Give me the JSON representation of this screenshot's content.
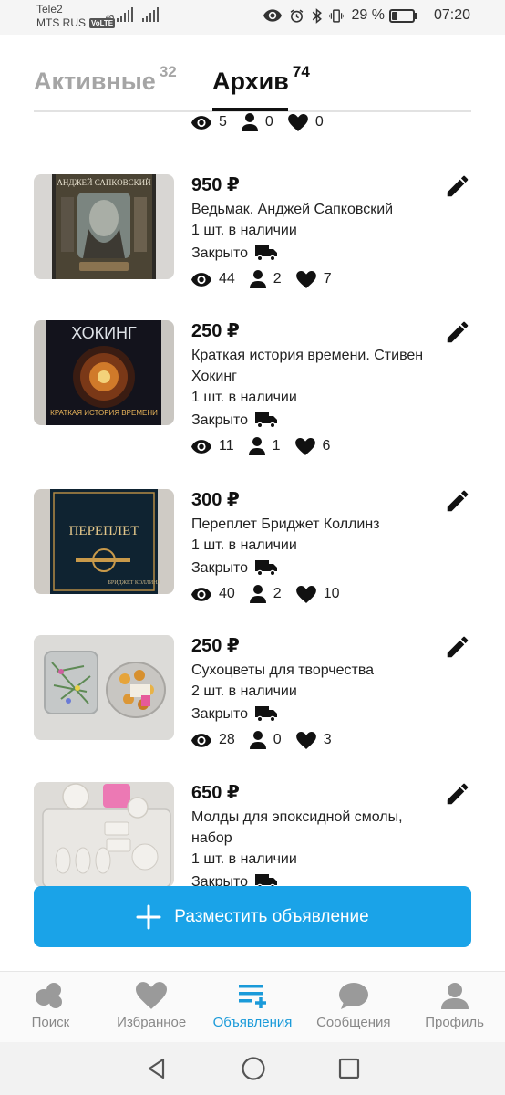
{
  "status_bar": {
    "carrier1": "Tele2",
    "carrier2": "MTS RUS",
    "volte": "VoLTE",
    "net1": "4G",
    "battery_text": "29 %",
    "battery_level": 0.29,
    "time": "07:20"
  },
  "tabs": [
    {
      "label": "Активные",
      "count": "32"
    },
    {
      "label": "Архив",
      "count": "74"
    }
  ],
  "partial_listing": {
    "views": "5",
    "contacts": "0",
    "likes": "0"
  },
  "listings": [
    {
      "price": "950 ₽",
      "title": "Ведьмак. Анджей Сапковский",
      "stock": "1 шт. в наличии",
      "status": "Закрыто",
      "views": "44",
      "contacts": "2",
      "likes": "7",
      "cover_text": "АНДЖЕЙ САПКОВСКИЙ"
    },
    {
      "price": "250 ₽",
      "title": "Краткая история времени. Стивен Хокинг",
      "stock": "1 шт. в наличии",
      "status": "Закрыто",
      "views": "11",
      "contacts": "1",
      "likes": "6",
      "cover_text": "ХОКИНГ",
      "cover_text2": "КРАТКАЯ ИСТОРИЯ ВРЕМЕНИ"
    },
    {
      "price": "300 ₽",
      "title": "Переплет Бриджет Коллинз",
      "stock": "1 шт. в наличии",
      "status": "Закрыто",
      "views": "40",
      "contacts": "2",
      "likes": "10",
      "cover_text": "ПЕРЕПЛЕТ",
      "cover_text2": "БРИДЖЕТ КОЛЛИНЗ"
    },
    {
      "price": "250 ₽",
      "title": "Сухоцветы для творчества",
      "stock": "2 шт. в наличии",
      "status": "Закрыто",
      "views": "28",
      "contacts": "0",
      "likes": "3"
    },
    {
      "price": "650 ₽",
      "title": "Молды для эпоксидной смолы, набор",
      "stock": "1 шт. в наличии",
      "status": "Закрыто"
    }
  ],
  "cta_label": "Разместить объявление",
  "bottom_nav": [
    {
      "label": "Поиск",
      "icon": "search-dots-icon"
    },
    {
      "label": "Избранное",
      "icon": "heart-icon"
    },
    {
      "label": "Объявления",
      "icon": "listings-add-icon",
      "active": true
    },
    {
      "label": "Сообщения",
      "icon": "chat-icon"
    },
    {
      "label": "Профиль",
      "icon": "profile-icon"
    }
  ],
  "colors": {
    "accent": "#1aa3e8",
    "active_nav": "#1a9ad9",
    "inactive_tab": "#a5a5a5"
  }
}
